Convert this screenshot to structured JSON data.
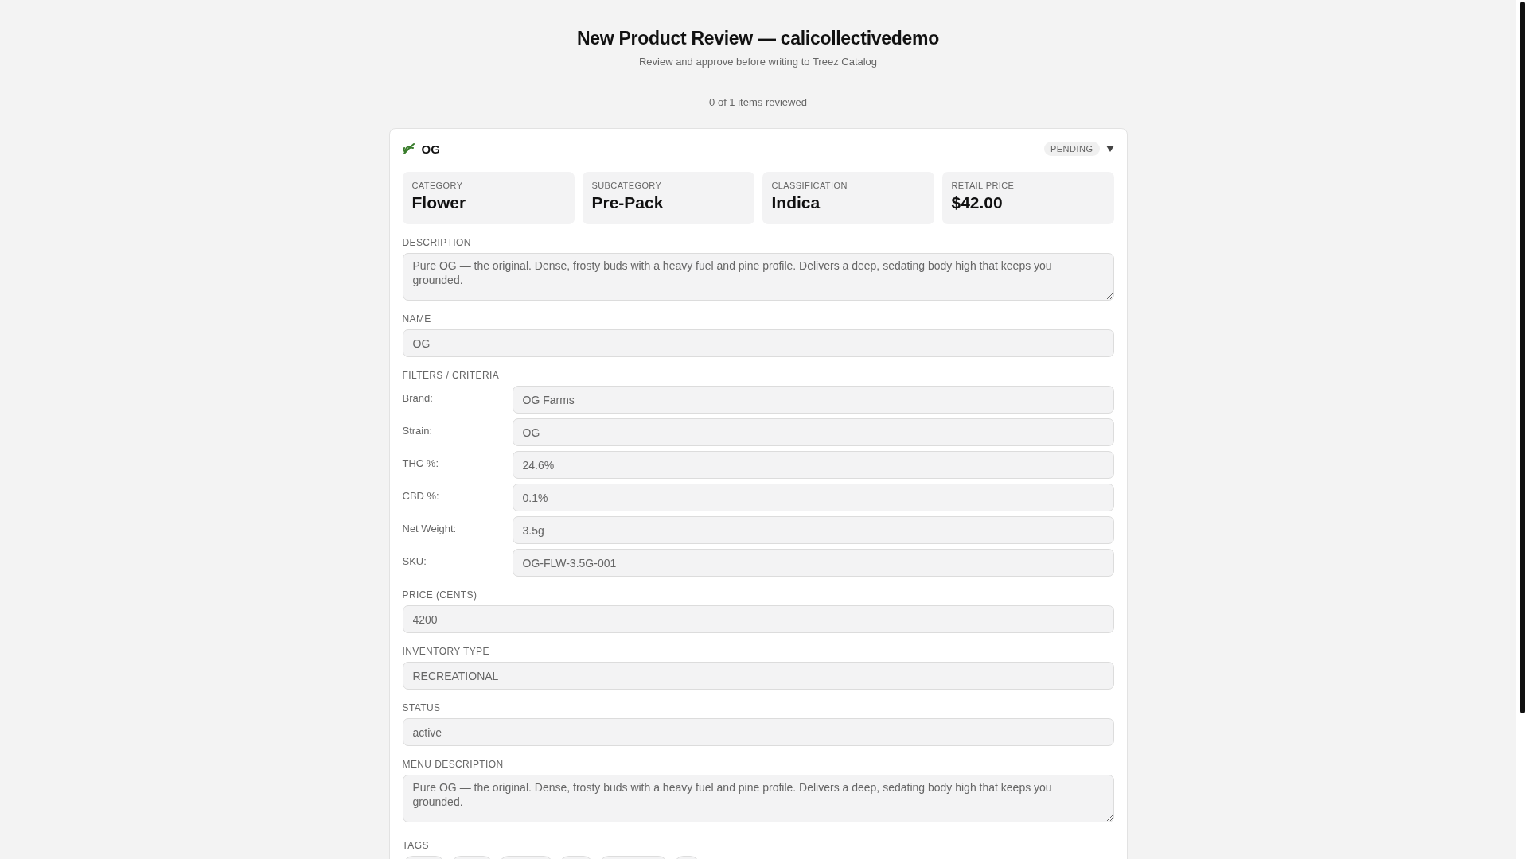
{
  "header": {
    "title": "New Product Review — calicollectivedemo",
    "subtitle": "Review and approve before writing to Treez Catalog",
    "progress": "0 of 1 items reviewed"
  },
  "product": {
    "name": "OG",
    "status": "PENDING",
    "expanded": true,
    "summary": [
      {
        "label": "CATEGORY",
        "value": "Flower"
      },
      {
        "label": "SUBCATEGORY",
        "value": "Pre-Pack"
      },
      {
        "label": "CLASSIFICATION",
        "value": "Indica"
      },
      {
        "label": "RETAIL PRICE",
        "value": "$42.00"
      }
    ],
    "description": {
      "label": "DESCRIPTION",
      "value": "Pure OG — the original. Dense, frosty buds with a heavy fuel and pine profile. Delivers a deep, sedating body high that keeps you grounded."
    },
    "name_field": {
      "label": "NAME",
      "value": "OG"
    },
    "filters": {
      "label": "FILTERS / CRITERIA",
      "rows": [
        {
          "label": "Brand:",
          "value": "OG Farms"
        },
        {
          "label": "Strain:",
          "value": "OG"
        },
        {
          "label": "THC %:",
          "value": "24.6%"
        },
        {
          "label": "CBD %:",
          "value": "0.1%"
        },
        {
          "label": "Net Weight:",
          "value": "3.5g"
        },
        {
          "label": "SKU:",
          "value": "OG-FLW-3.5G-001"
        }
      ]
    },
    "fields": [
      {
        "kind": "input",
        "label": "PRICE (CENTS)",
        "value": "4200"
      },
      {
        "kind": "input",
        "label": "INVENTORY TYPE",
        "value": "RECREATIONAL"
      },
      {
        "kind": "input",
        "label": "STATUS",
        "value": "active"
      },
      {
        "kind": "textarea",
        "label": "MENU DESCRIPTION",
        "value": "Pure OG — the original. Dense, frosty buds with a heavy fuel and pine profile. Delivers a deep, sedating body high that keeps you grounded."
      }
    ],
    "tags": {
      "label": "TAGS"
    }
  }
}
